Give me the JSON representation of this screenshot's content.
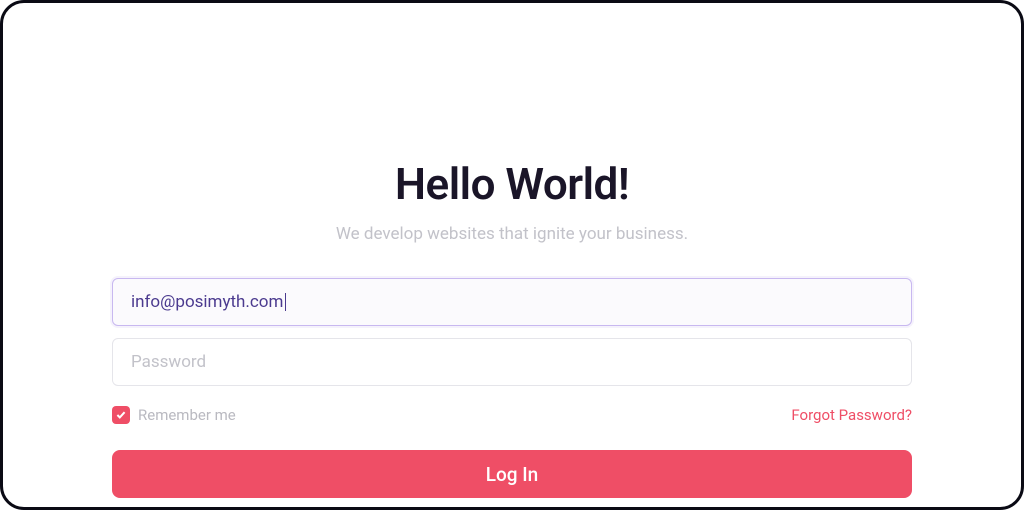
{
  "header": {
    "title": "Hello World!",
    "subtitle": "We develop websites that ignite your business."
  },
  "form": {
    "email_value": "info@posimyth.com",
    "password_placeholder": "Password",
    "remember_label": "Remember me",
    "remember_checked": true,
    "forgot_label": "Forgot Password?",
    "login_label": "Log In"
  },
  "colors": {
    "accent": "#ef4e66",
    "input_focus_border": "#c8b8f0",
    "text_dark": "#1a1528",
    "text_muted": "#c2c2c9"
  }
}
